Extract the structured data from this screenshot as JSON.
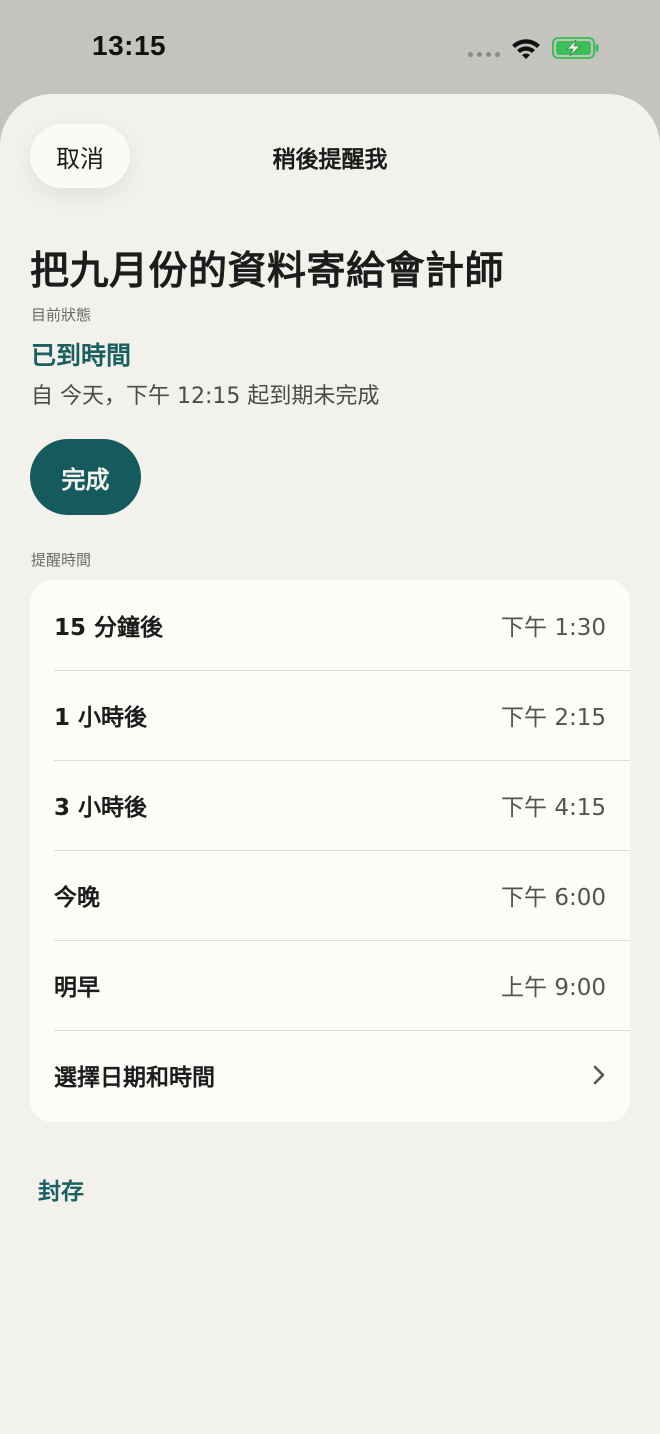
{
  "status_bar": {
    "time": "13:15",
    "icons": [
      "signal-dots-icon",
      "wifi-icon",
      "battery-charging-icon"
    ]
  },
  "header": {
    "cancel_label": "取消",
    "title": "稍後提醒我"
  },
  "task": {
    "title": "把九月份的資料寄給會計師",
    "status_label": "目前狀態",
    "status_value": "已到時間",
    "status_detail": "自 今天，下午 12:15 起到期未完成",
    "done_label": "完成"
  },
  "reminder": {
    "section_label": "提醒時間",
    "options": [
      {
        "label": "15 分鐘後",
        "time": "下午 1:30"
      },
      {
        "label": "1 小時後",
        "time": "下午 2:15"
      },
      {
        "label": "3 小時後",
        "time": "下午 4:15"
      },
      {
        "label": "今晚",
        "time": "下午 6:00"
      },
      {
        "label": "明早",
        "time": "上午 9:00"
      }
    ],
    "custom_label": "選擇日期和時間"
  },
  "archive_label": "封存",
  "colors": {
    "accent": "#1b5f61",
    "done_button": "#155a5c",
    "sheet_background": "#f3f1ec",
    "card_background": "#fdfcf8",
    "battery_fill": "#3fbf5a"
  }
}
